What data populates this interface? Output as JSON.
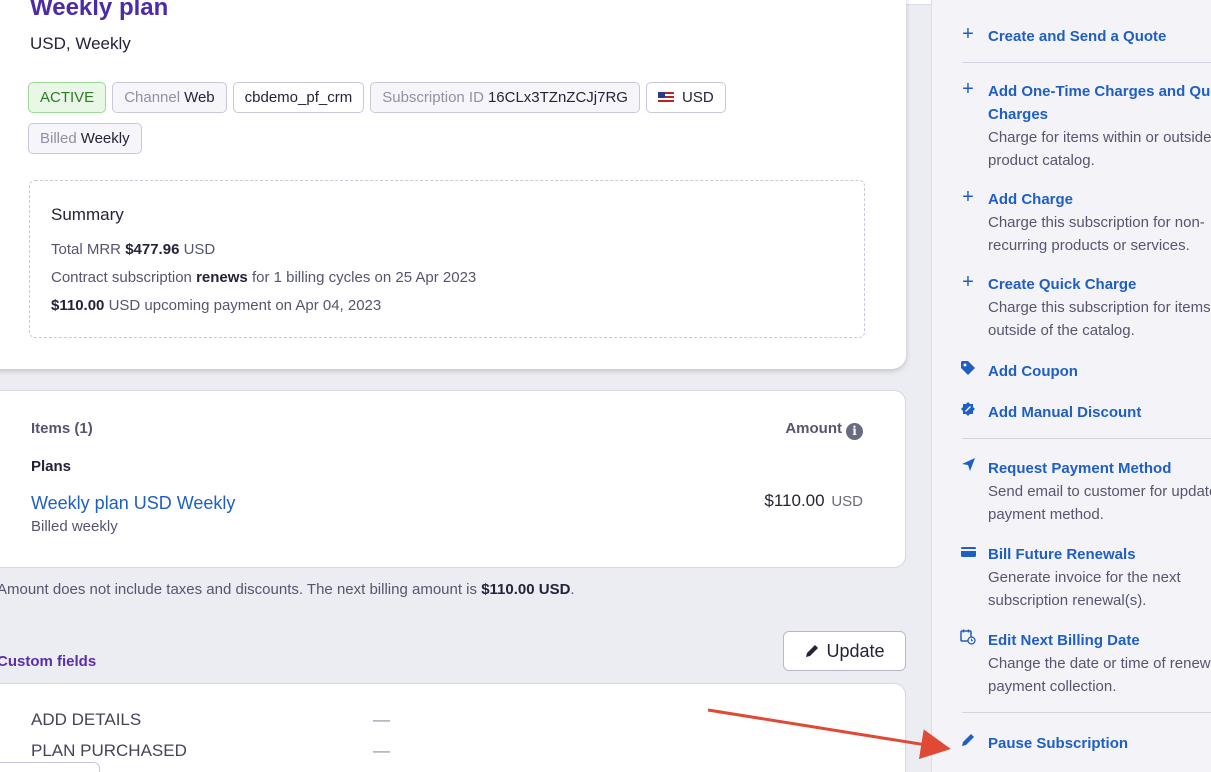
{
  "plan": {
    "title": "Weekly plan",
    "subtitle": "USD, Weekly"
  },
  "badges": {
    "status": "ACTIVE",
    "channel_label": "Channel",
    "channel_value": "Web",
    "site": "cbdemo_pf_crm",
    "subscription_id_label": "Subscription ID",
    "subscription_id_value": "16CLx3TZnZCJj7RG",
    "currency": "USD",
    "billed_label": "Billed",
    "billed_value": "Weekly"
  },
  "summary": {
    "title": "Summary",
    "mrr_prefix": "Total MRR",
    "mrr_value": "$477.96",
    "mrr_suffix": "USD",
    "contract_prefix": "Contract subscription",
    "contract_bold": "renews",
    "contract_suffix": "for 1 billing cycles on 25 Apr 2023",
    "upcoming_value": "$110.00",
    "upcoming_suffix": "USD upcoming payment on Apr 04, 2023"
  },
  "items": {
    "header": "Items (1)",
    "amount_header": "Amount",
    "info_glyph": "i",
    "plans_label": "Plans",
    "plan_name": "Weekly plan USD Weekly",
    "plan_billing": "Billed weekly",
    "plan_price": "$110.00",
    "plan_currency": "USD"
  },
  "note": {
    "prefix": "Amount does not include taxes and discounts. The next billing amount is",
    "amount": "$110.00 USD",
    "suffix": "."
  },
  "custom_fields": {
    "title": "Custom fields",
    "update_label": "Update",
    "rows": [
      {
        "label": "ADD DETAILS",
        "value": "—"
      },
      {
        "label": "PLAN PURCHASED",
        "value": "—"
      }
    ]
  },
  "actions": [
    {
      "icon": "plus-icon",
      "title": "Create and Send a Quote",
      "desc": []
    },
    {
      "icon": "plus-icon",
      "title": "Add One-Time Charges and Quote",
      "title2": "Charges",
      "desc": [
        "Charge for items within or outside",
        "product catalog."
      ]
    },
    {
      "icon": "plus-icon",
      "title": "Add Charge",
      "desc": [
        "Charge this subscription for non-",
        "recurring products or services."
      ]
    },
    {
      "icon": "plus-icon",
      "title": "Create Quick Charge",
      "desc": [
        "Charge this subscription for items",
        "outside of the catalog."
      ]
    },
    {
      "icon": "tag-icon",
      "title": "Add Coupon",
      "desc": []
    },
    {
      "icon": "discount-badge-icon",
      "title": "Add Manual Discount",
      "desc": []
    },
    {
      "icon": "paper-plane-icon",
      "title": "Request Payment Method",
      "desc": [
        "Send email to customer for update",
        "payment method."
      ]
    },
    {
      "icon": "card-icon",
      "title": "Bill Future Renewals",
      "desc": [
        "Generate invoice for the next",
        "subscription renewal(s)."
      ]
    },
    {
      "icon": "calendar-clock-icon",
      "title": "Edit Next Billing Date",
      "desc": [
        "Change the date or time of renewal",
        "payment collection."
      ]
    },
    {
      "icon": "pencil-icon",
      "title": "Pause Subscription",
      "desc": []
    }
  ],
  "colors": {
    "accent": "#1f5fc4",
    "title_purple": "#4d2aa8",
    "annotation_arrow": "#e04a35"
  }
}
